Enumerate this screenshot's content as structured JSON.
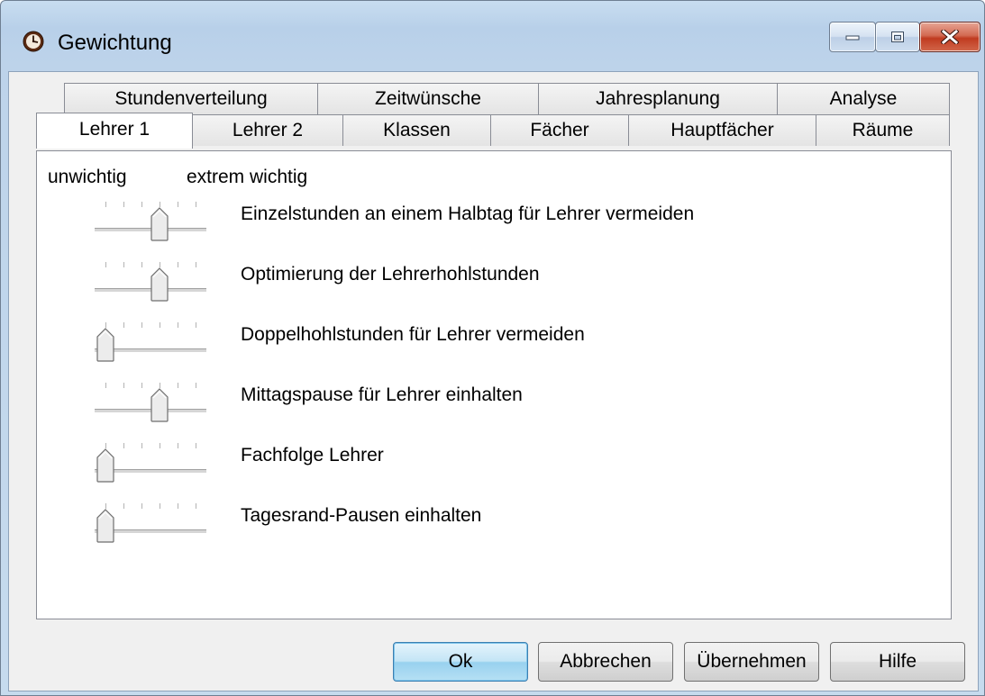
{
  "window": {
    "title": "Gewichtung",
    "icon": "clock-icon",
    "controls": [
      "minimize-icon",
      "maximize-icon",
      "close-icon"
    ]
  },
  "tabs": {
    "row_back": [
      "Stundenverteilung",
      "Zeitwünsche",
      "Jahresplanung",
      "Analyse"
    ],
    "row_front": [
      "Lehrer 1",
      "Lehrer 2",
      "Klassen",
      "Fächer",
      "Hauptfächer",
      "Räume"
    ],
    "active": "Lehrer 1"
  },
  "scale": {
    "low": "unwichtig",
    "high": "extrem wichtig"
  },
  "options": [
    {
      "label": "Einzelstunden an einem Halbtag für Lehrer vermeiden",
      "level": 3,
      "max": 5
    },
    {
      "label": "Optimierung der Lehrerhohlstunden",
      "level": 3,
      "max": 5
    },
    {
      "label": "Doppelhohlstunden für Lehrer vermeiden",
      "level": 0,
      "max": 5
    },
    {
      "label": "Mittagspause für Lehrer einhalten",
      "level": 3,
      "max": 5
    },
    {
      "label": "Fachfolge Lehrer",
      "level": 0,
      "max": 5
    },
    {
      "label": "Tagesrand-Pausen einhalten",
      "level": 0,
      "max": 5
    }
  ],
  "buttons": {
    "ok": "Ok",
    "cancel": "Abbrechen",
    "apply": "Übernehmen",
    "help": "Hilfe"
  }
}
